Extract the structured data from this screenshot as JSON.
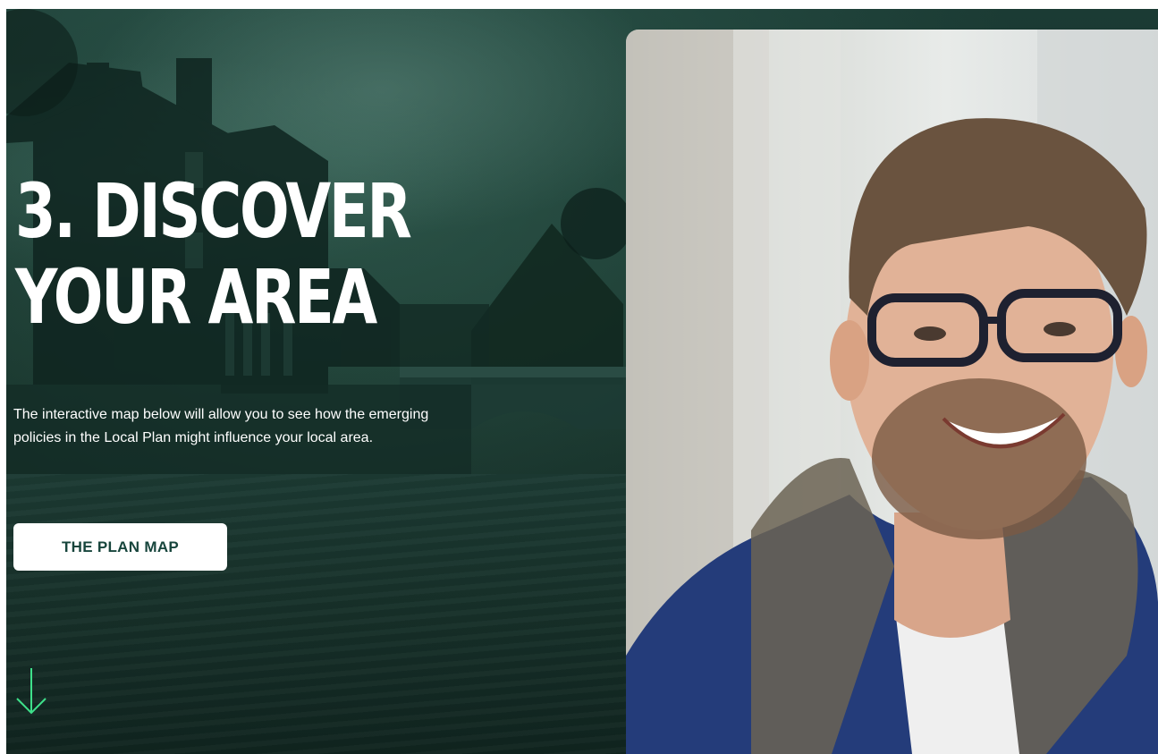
{
  "hero": {
    "headline": "3. DISCOVER YOUR AREA",
    "intro": "The interactive map below will allow you to see how the emerging policies in the Local Plan might influence your local area.",
    "cta_label": "THE PLAN MAP",
    "scroll_icon": "arrow-down-icon"
  },
  "colors": {
    "overlay": "#17342d",
    "button_text": "#17453c",
    "accent": "#3ee08a"
  },
  "photo": {
    "subject": "man-with-glasses-photo"
  }
}
